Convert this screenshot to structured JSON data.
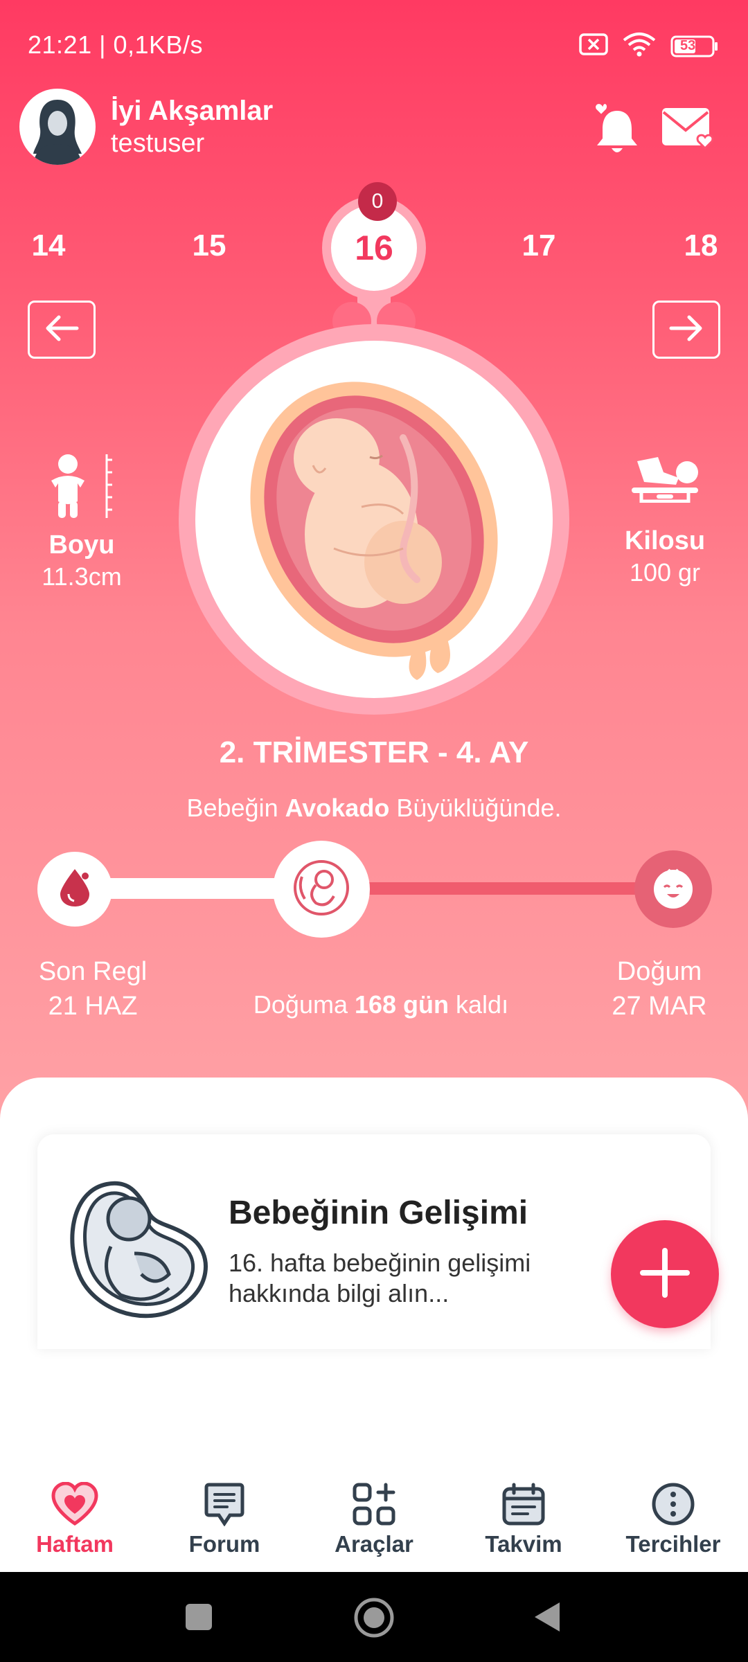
{
  "status_bar": {
    "time": "21:21 | 0,1KB/s",
    "battery": "53"
  },
  "header": {
    "greeting": "İyi Akşamlar",
    "username": "testuser"
  },
  "weeks": {
    "items": [
      "14",
      "15",
      "16",
      "17",
      "18"
    ],
    "current": "16",
    "badge": "0"
  },
  "stats": {
    "height_label": "Boyu",
    "height_value": "11.3cm",
    "weight_label": "Kilosu",
    "weight_value": "100 gr"
  },
  "trimester": "2. TRİMESTER - 4. AY",
  "size": {
    "prefix": "Bebeğin ",
    "fruit": "Avokado",
    "suffix": " Büyüklüğünde."
  },
  "timeline": {
    "start_label": "Son Regl",
    "start_date": "21 HAZ",
    "end_label": "Doğum",
    "end_date": "27 MAR",
    "countdown_prefix": "Doğuma ",
    "countdown_value": "168 gün",
    "countdown_suffix": " kaldı"
  },
  "card": {
    "title": "Bebeğinin Gelişimi",
    "description": "16. hafta bebeğinin gelişimi hakkında bilgi alın..."
  },
  "nav": [
    {
      "label": "Haftam",
      "icon": "heart-icon",
      "active": true
    },
    {
      "label": "Forum",
      "icon": "chat-icon",
      "active": false
    },
    {
      "label": "Araçlar",
      "icon": "tools-icon",
      "active": false
    },
    {
      "label": "Takvim",
      "icon": "calendar-icon",
      "active": false
    },
    {
      "label": "Tercihler",
      "icon": "more-icon",
      "active": false
    }
  ],
  "colors": {
    "accent": "#f2385e",
    "badge": "#c42a49",
    "text_dark": "#33404d"
  }
}
